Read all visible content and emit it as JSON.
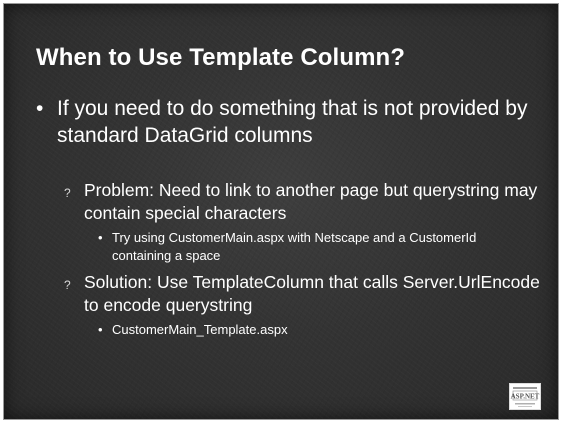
{
  "slide": {
    "title": "When to Use Template Column?",
    "bullet": "If you need to do something that is not provided by standard  DataGrid columns",
    "items": [
      {
        "marker": "?",
        "text": "Problem: Need to link to another page but querystring may contain special characters",
        "sub": "Try using CustomerMain.aspx  with Netscape and a CustomerId containing a space"
      },
      {
        "marker": "?",
        "text": "Solution: Use TemplateColumn that calls Server.UrlEncode to encode querystring",
        "sub": "CustomerMain_Template.aspx"
      }
    ],
    "bullet_glyph": "•",
    "logo_text": "ASP.NET"
  }
}
